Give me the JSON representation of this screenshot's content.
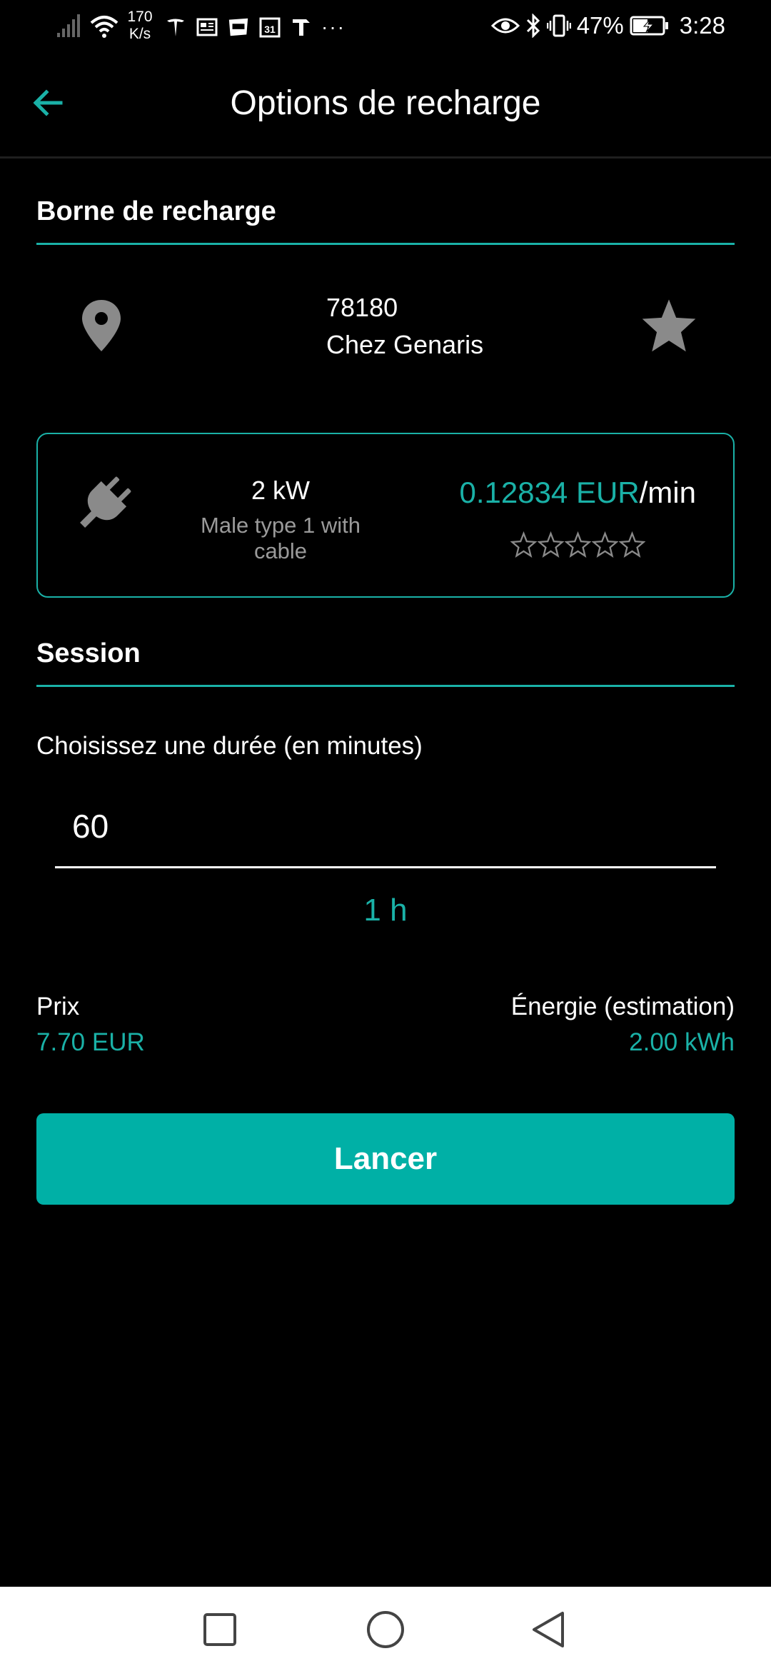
{
  "status_bar": {
    "network_speed_value": "170",
    "network_speed_unit": "K/s",
    "app_icons": [
      "tesla-icon",
      "news-icon",
      "webtoon-icon",
      "calendar-31-icon",
      "hammer-icon"
    ],
    "more_label": "···",
    "battery_percent": "47%",
    "time": "3:28"
  },
  "app_bar": {
    "title": "Options de recharge"
  },
  "station_section": {
    "title": "Borne de recharge",
    "postal_code": "78180",
    "name": "Chez Genaris"
  },
  "connector": {
    "power": "2 kW",
    "type": "Male type 1 with cable",
    "price_amount": "0.12834 EUR",
    "price_unit": "/min",
    "rating_stars": 0,
    "rating_max": 5
  },
  "session_section": {
    "title": "Session",
    "duration_label": "Choisissez une durée (en minutes)",
    "duration_value": "60",
    "duration_display": "1 h"
  },
  "estimates": {
    "price_label": "Prix",
    "price_value": "7.70 EUR",
    "energy_label": "Énergie (estimation)",
    "energy_value": "2.00 kWh"
  },
  "actions": {
    "launch_label": "Lancer"
  },
  "colors": {
    "accent": "#1ab1a7",
    "button": "#00b0a6",
    "background": "#000000",
    "muted_text": "#9a9a9a"
  }
}
